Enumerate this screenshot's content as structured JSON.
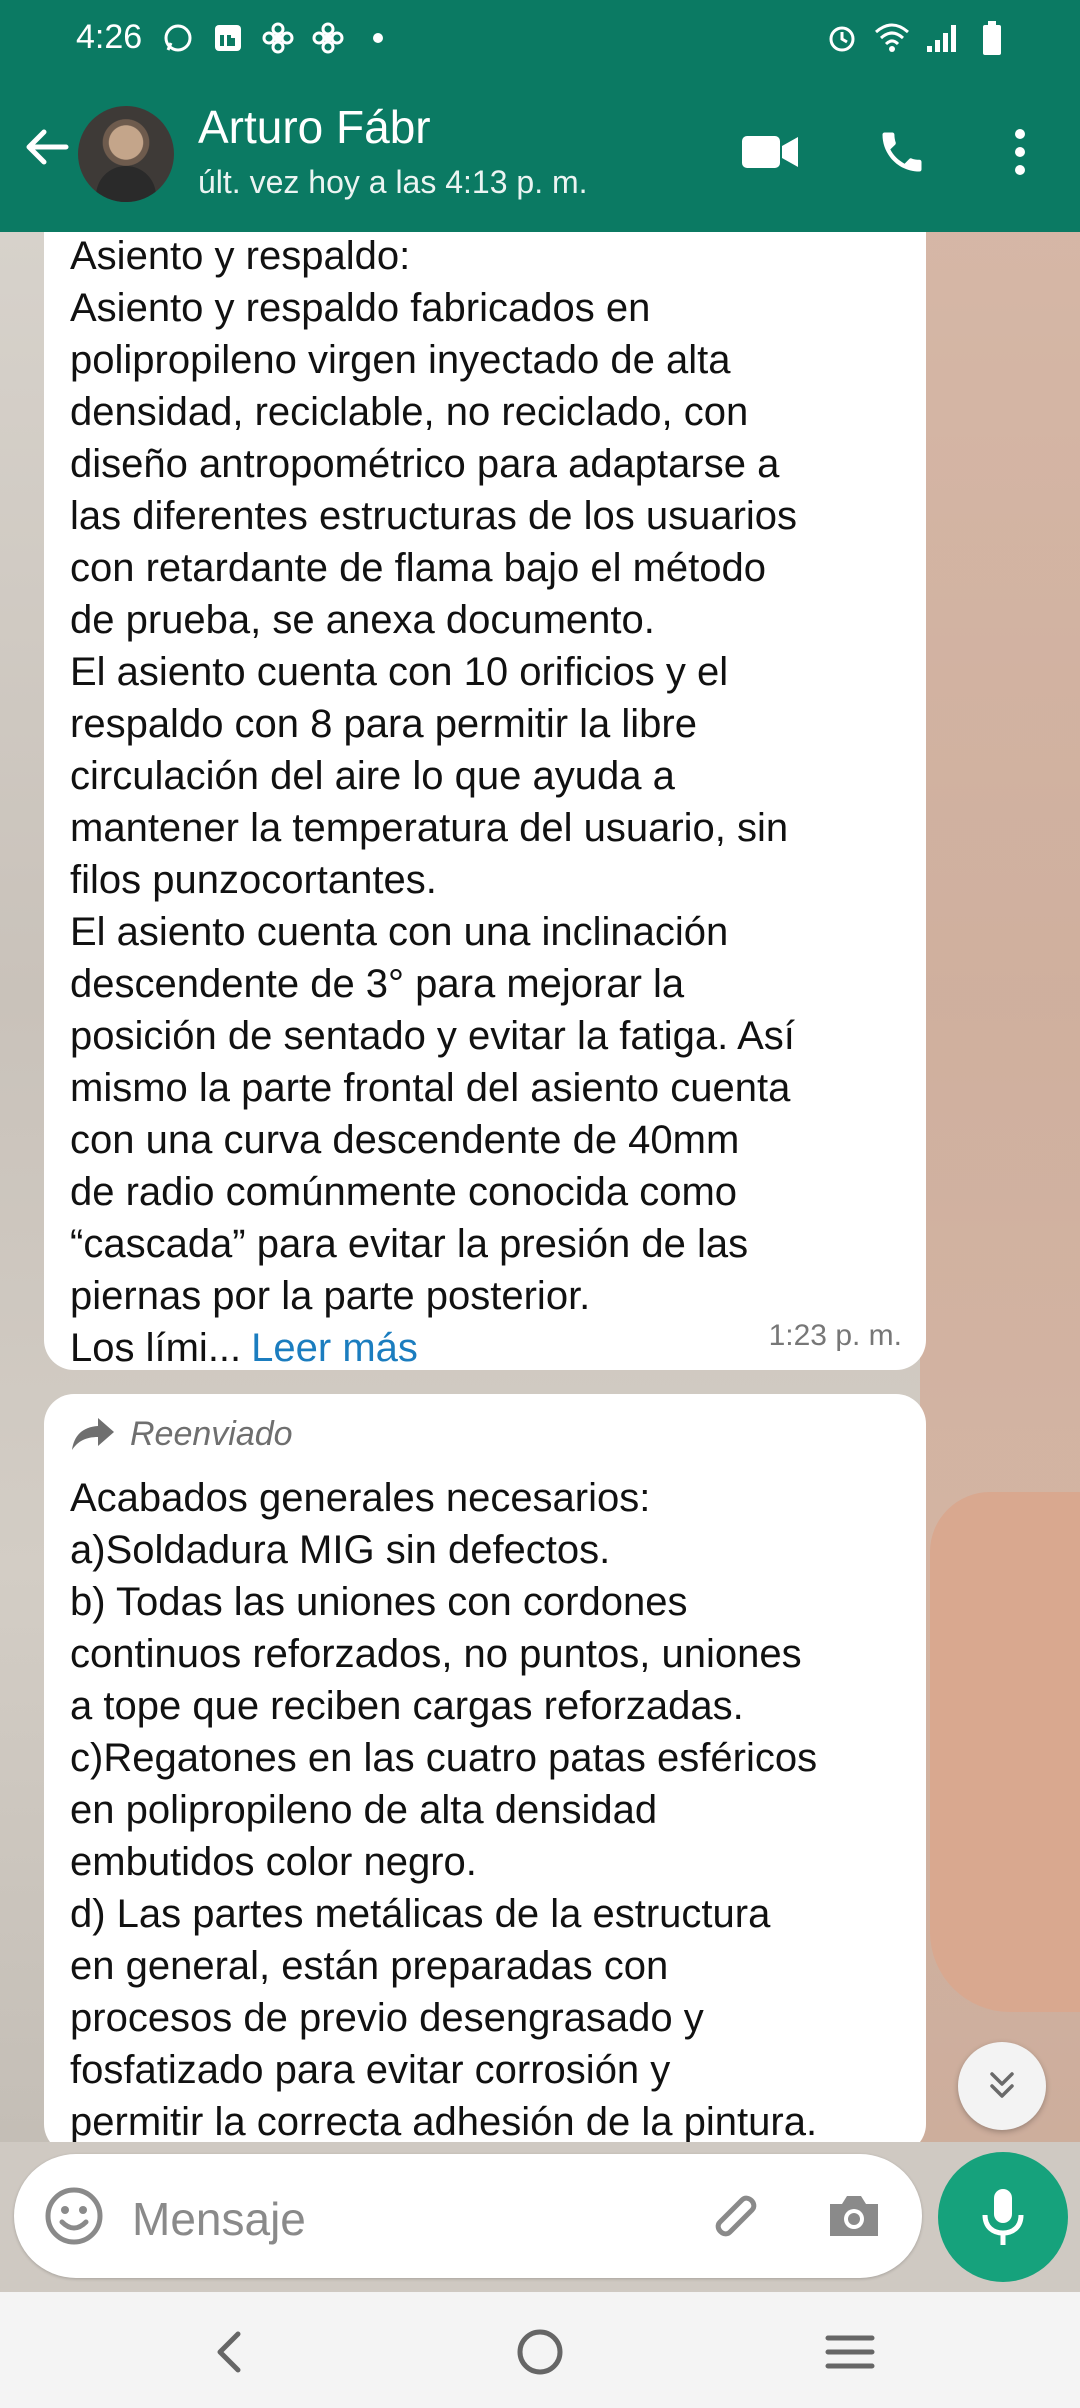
{
  "status_bar": {
    "time": "4:26",
    "left_icons": [
      "whatsapp-icon",
      "linkedin-icon",
      "fan-icon",
      "fan-icon",
      "dot-icon"
    ],
    "right_icons": [
      "alarm-icon",
      "wifi-icon",
      "signal-icon",
      "battery-icon"
    ]
  },
  "header": {
    "contact_name": "Arturo Fábr",
    "last_seen": "últ. vez hoy a las 4:13 p. m.",
    "icons": [
      "back-arrow-icon",
      "video-call-icon",
      "phone-icon",
      "more-vert-icon"
    ]
  },
  "messages": [
    {
      "lines": [
        "Asiento y respaldo:",
        "Asiento y respaldo fabricados en",
        "polipropileno virgen inyectado de alta",
        "densidad, reciclable, no reciclado, con",
        "diseño antropométrico para adaptarse a",
        "las diferentes estructuras de los usuarios",
        "con retardante de flama bajo el método",
        "de prueba, se anexa documento.",
        "El asiento cuenta con 10 orificios y el",
        "respaldo con 8 para permitir la libre",
        "circulación del aire lo que ayuda a",
        "mantener la temperatura del usuario, sin",
        "filos punzocortantes.",
        "El asiento cuenta con una inclinación",
        "descendente de 3° para mejorar la",
        "posición de sentado y evitar la fatiga. Así",
        "mismo la parte frontal del asiento cuenta",
        "con una curva descendente de 40mm",
        "de radio comúnmente conocida como",
        "“cascada” para evitar la presión de las",
        "piernas por la parte posterior."
      ],
      "truncated_text": "Los lími...",
      "read_more": "Leer más",
      "time": "1:23 p. m."
    },
    {
      "forwarded_label": "Reenviado",
      "lines": [
        "Acabados generales necesarios:",
        "a)Soldadura MIG sin defectos.",
        "b)  Todas las uniones con cordones",
        "continuos reforzados, no puntos, uniones",
        "a tope que reciben cargas reforzadas.",
        "c)Regatones en las cuatro patas esféricos",
        "en polipropileno de alta densidad",
        "embutidos color negro.",
        "d)  Las partes metálicas de la estructura",
        "en general, están preparadas con",
        "procesos de previo desengrasado y",
        "fosfatizado para evitar corrosión y",
        "permitir la correcta adhesión de la pintura."
      ]
    }
  ],
  "composer": {
    "placeholder": "Mensaje",
    "icons": [
      "emoji-icon",
      "attach-icon",
      "camera-icon",
      "mic-icon"
    ]
  },
  "navbar": {
    "icons": [
      "nav-back-icon",
      "nav-home-icon",
      "nav-recents-icon"
    ]
  },
  "colors": {
    "header_bg": "#0b7a63",
    "mic_bg": "#16a27c",
    "link": "#1b7dbf",
    "bubble_bg": "#ffffff"
  }
}
